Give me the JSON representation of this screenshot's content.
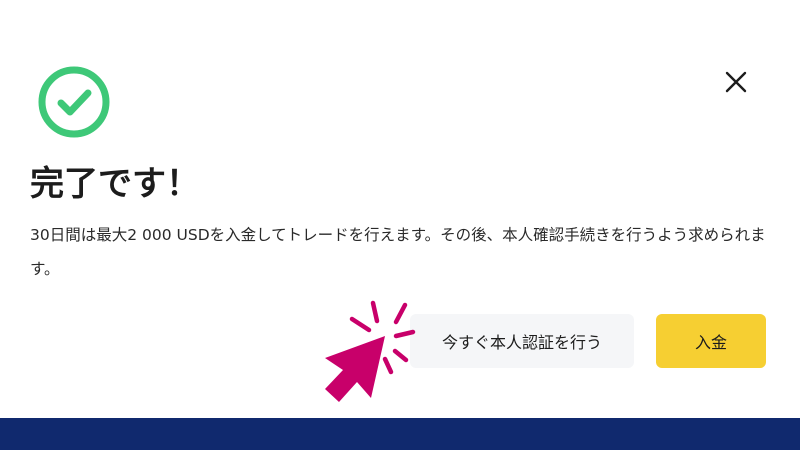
{
  "dialog": {
    "title": "完了です！",
    "message": "30日間は最大2 000 USDを入金してトレードを行えます。その後、本人確認手続きを行うよう求められます。",
    "status_icon": "check-circle-icon",
    "close_icon": "close-icon"
  },
  "actions": {
    "verify_label": "今すぐ本人認証を行う",
    "deposit_label": "入金"
  },
  "colors": {
    "success": "#3ec878",
    "deposit_button": "#f6cf32",
    "verify_button": "#f5f6f8",
    "pointer_annotation": "#c8006a",
    "footer": "#10296e",
    "text": "#1c1c1c"
  }
}
